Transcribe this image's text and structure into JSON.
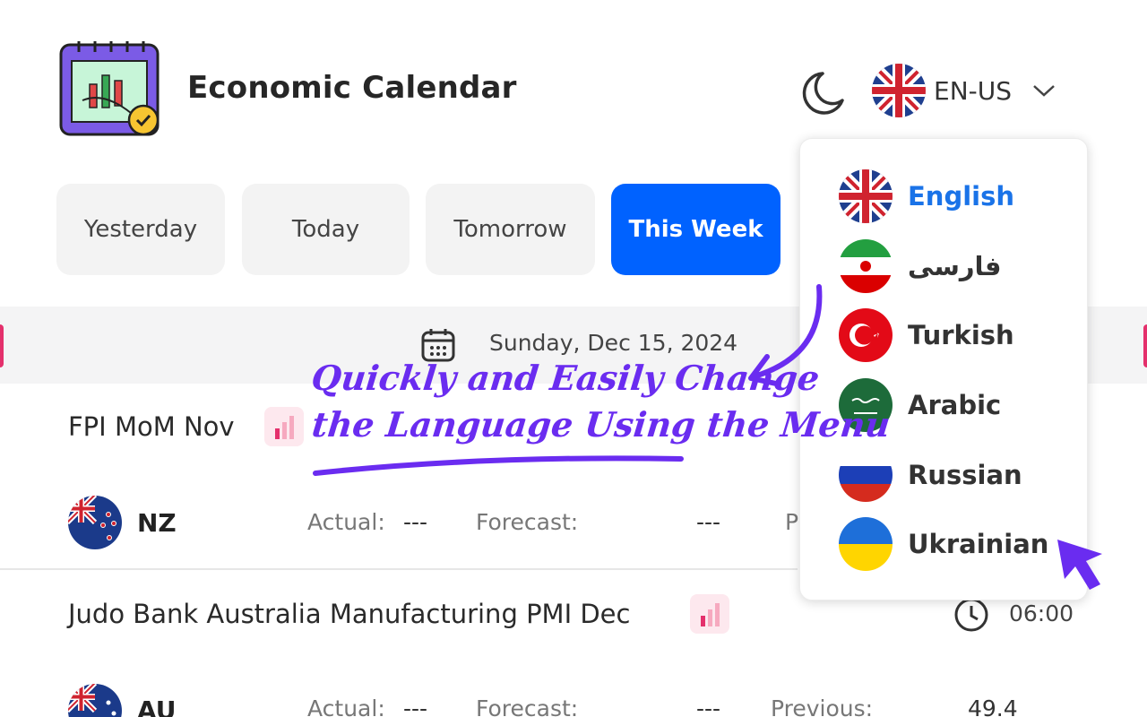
{
  "header": {
    "app_title": "Economic Calendar",
    "logo_icon": "calendar-chart-icon",
    "theme_icon": "moon-icon",
    "language_code": "EN-US",
    "language_flag_icon": "uk-flag-icon"
  },
  "tabs": [
    {
      "label": "Yesterday",
      "active": false
    },
    {
      "label": "Today",
      "active": false
    },
    {
      "label": "Tomorrow",
      "active": false
    },
    {
      "label": "This Week",
      "active": true
    }
  ],
  "date_strip": {
    "date": "Sunday, Dec 15, 2024",
    "icon": "calendar-icon"
  },
  "events": [
    {
      "title": "FPI MoM Nov",
      "country": "NZ",
      "country_flag": "nz-flag-icon",
      "actual_label": "Actual:",
      "actual": "---",
      "forecast_label": "Forecast:",
      "forecast": "---",
      "previous_label": "P"
    },
    {
      "title": "Judo Bank Australia Manufacturing PMI Dec",
      "time": "06:00",
      "country": "AU",
      "country_flag": "au-flag-icon",
      "actual_label": "Actual:",
      "actual": "---",
      "forecast_label": "Forecast:",
      "forecast": "---",
      "previous_label": "Previous:",
      "previous": "49.4"
    }
  ],
  "language_menu": [
    {
      "label": "English",
      "flag": "uk-flag-icon",
      "selected": true
    },
    {
      "label": "فارسی",
      "flag": "iran-flag-icon",
      "selected": false
    },
    {
      "label": "Turkish",
      "flag": "turkey-flag-icon",
      "selected": false
    },
    {
      "label": "Arabic",
      "flag": "saudi-flag-icon",
      "selected": false
    },
    {
      "label": "Russian",
      "flag": "russia-flag-icon",
      "selected": false
    },
    {
      "label": "Ukrainian",
      "flag": "ukraine-flag-icon",
      "selected": false
    }
  ],
  "promo": {
    "line1": "Quickly and Easily Change",
    "line2": "the Language Using the Menu"
  },
  "colors": {
    "accent": "#0062ff",
    "promo": "#6a2cf0",
    "selected_language": "#1a73e8",
    "impact_bg": "#fde8ee"
  }
}
